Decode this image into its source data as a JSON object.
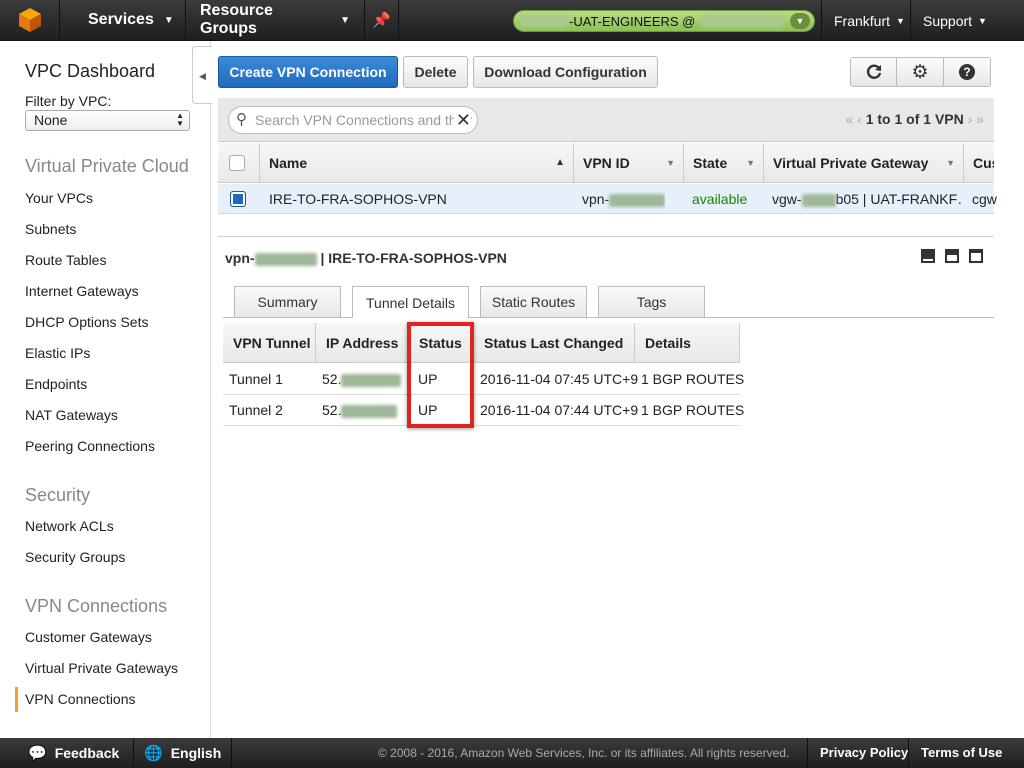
{
  "topbar": {
    "services": "Services",
    "resource_groups": "Resource Groups",
    "account": "-UAT-ENGINEERS @",
    "region": "Frankfurt",
    "support": "Support"
  },
  "sidebar": {
    "title": "VPC Dashboard",
    "filter_label": "Filter by VPC:",
    "filter_value": "None",
    "sections": [
      {
        "title": "Virtual Private Cloud",
        "items": [
          "Your VPCs",
          "Subnets",
          "Route Tables",
          "Internet Gateways",
          "DHCP Options Sets",
          "Elastic IPs",
          "Endpoints",
          "NAT Gateways",
          "Peering Connections"
        ]
      },
      {
        "title": "Security",
        "items": [
          "Network ACLs",
          "Security Groups"
        ]
      },
      {
        "title": "VPN Connections",
        "items": [
          "Customer Gateways",
          "Virtual Private Gateways",
          "VPN Connections"
        ]
      }
    ]
  },
  "toolbar": {
    "create": "Create VPN Connection",
    "delete": "Delete",
    "download": "Download Configuration"
  },
  "search": {
    "placeholder": "Search VPN Connections and their pr",
    "pager": "1 to 1 of 1 VPN"
  },
  "table": {
    "columns": [
      "Name",
      "VPN ID",
      "State",
      "Virtual Private Gateway",
      "Cus"
    ],
    "row": {
      "name": "IRE-TO-FRA-SOPHOS-VPN",
      "vpn_id": "vpn-",
      "state": "available",
      "vgw_prefix": "vgw-",
      "vgw_suffix": "b05 | UAT-FRANKF…",
      "customer": "cgw"
    }
  },
  "detail": {
    "title_prefix": "vpn-",
    "title_suffix": "| IRE-TO-FRA-SOPHOS-VPN",
    "tabs": [
      "Summary",
      "Tunnel Details",
      "Static Routes",
      "Tags"
    ],
    "columns": [
      "VPN Tunnel",
      "IP Address",
      "Status",
      "Status Last Changed",
      "Details"
    ],
    "rows": [
      {
        "tunnel": "Tunnel 1",
        "ip": "52.",
        "status": "UP",
        "changed": "2016-11-04 07:45 UTC+9",
        "details": "1 BGP ROUTES"
      },
      {
        "tunnel": "Tunnel 2",
        "ip": "52.",
        "status": "UP",
        "changed": "2016-11-04 07:44 UTC+9",
        "details": "1 BGP ROUTES"
      }
    ]
  },
  "footer": {
    "feedback": "Feedback",
    "language": "English",
    "copyright": "© 2008 - 2016, Amazon Web Services, Inc. or its affiliates. All rights reserved.",
    "privacy": "Privacy Policy",
    "terms": "Terms of Use"
  },
  "colors": {
    "accent": "#1f6bbf",
    "available": "#1d8102",
    "highlight": "#e3241b",
    "nav": "#2b2b2b"
  }
}
